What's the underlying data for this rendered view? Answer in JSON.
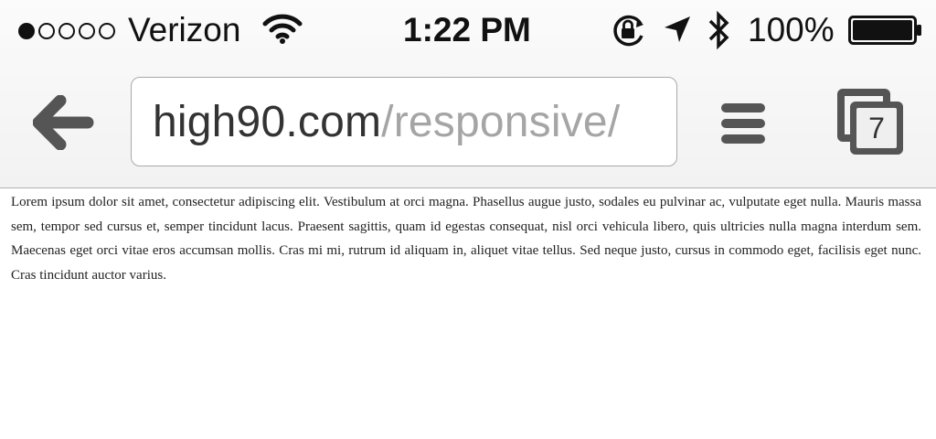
{
  "status_bar": {
    "signal_total": 5,
    "signal_filled": 1,
    "carrier": "Verizon",
    "time": "1:22 PM",
    "battery_percent": "100%",
    "battery_level": 1.0,
    "icons": [
      "wifi-icon",
      "rotation-lock-icon",
      "location-arrow-icon",
      "bluetooth-icon",
      "battery-icon"
    ]
  },
  "toolbar": {
    "back_icon": "back-arrow-icon",
    "url_domain": "high90.com",
    "url_path": "/responsive/",
    "menu_icon": "hamburger-menu-icon",
    "tab_count": "7"
  },
  "page": {
    "body_text": "Lorem ipsum dolor sit amet, consectetur adipiscing elit. Vestibulum at orci magna. Phasellus augue justo, sodales eu pulvinar ac, vulputate eget nulla. Mauris massa sem, tempor sed cursus et, semper tincidunt lacus. Praesent sagittis, quam id egestas consequat, nisl orci vehicula libero, quis ultricies nulla magna interdum sem. Maecenas eget orci vitae eros accumsan mollis. Cras mi mi, rutrum id aliquam in, aliquet vitae tellus. Sed neque justo, cursus in commodo eget, facilisis eget nunc. Cras tincidunt auctor varius."
  }
}
